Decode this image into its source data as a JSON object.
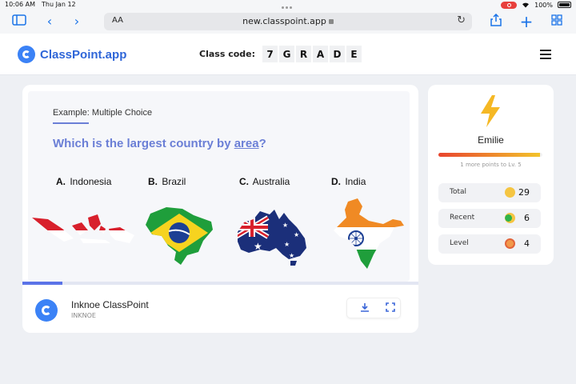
{
  "status_bar": {
    "time": "10:06 AM",
    "date": "Thu Jan 12",
    "battery": "100%"
  },
  "browser": {
    "text_size_label": "AA",
    "url": "new.classpoint.app"
  },
  "app": {
    "logo_text": "ClassPoint.app",
    "class_code_label": "Class code:",
    "class_code": [
      "7",
      "G",
      "R",
      "A",
      "D",
      "E"
    ]
  },
  "slide": {
    "example_label": "Example: Multiple Choice",
    "question_before": "Which is the largest country by ",
    "question_link": "area",
    "question_after": "?",
    "options": [
      {
        "letter": "A.",
        "text": "Indonesia"
      },
      {
        "letter": "B.",
        "text": "Brazil"
      },
      {
        "letter": "C.",
        "text": "Australia"
      },
      {
        "letter": "D.",
        "text": "India"
      }
    ],
    "progress_fraction": 0.1
  },
  "presenter": {
    "name": "Inknoe ClassPoint",
    "org": "INKNOE"
  },
  "profile": {
    "name": "Emilie",
    "level_progress_fraction": 0.98,
    "level_hint": "1 more points to Lv. 5",
    "stats": [
      {
        "label": "Total",
        "value": "29"
      },
      {
        "label": "Recent",
        "value": "6"
      },
      {
        "label": "Level",
        "value": "4"
      }
    ]
  },
  "colors": {
    "accent": "#6b7fd6",
    "brand": "#2f66d8",
    "xp_start": "#e8452e",
    "xp_end": "#f3c32b"
  }
}
